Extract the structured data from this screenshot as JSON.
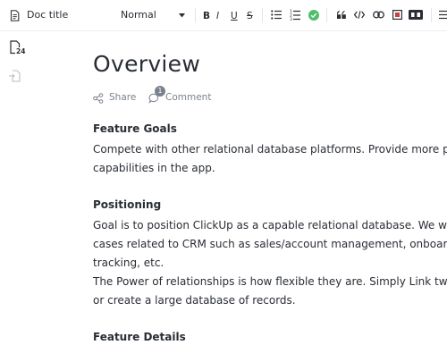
{
  "toolbar": {
    "doc_title": "Doc title",
    "text_style": "Normal",
    "format_letters": {
      "bold": "B",
      "italic": "I",
      "underline": "U",
      "strike": "S"
    },
    "icons": [
      "doc-icon",
      "chevron-down-icon",
      "bullet-list-icon",
      "numbered-list-icon",
      "checklist-icon",
      "quote-icon",
      "code-icon",
      "link-icon",
      "embed-icon",
      "banner-icon",
      "more-icon"
    ],
    "accent_color": "#4fbf6b"
  },
  "sidebar": {
    "page_count_badge": "24"
  },
  "document": {
    "heading": "Overview",
    "actions": {
      "share_label": "Share",
      "comment_label": "Comment",
      "comment_count": "1"
    },
    "sections": [
      {
        "title": "Feature Goals",
        "lines": [
          "Compete with other relational database platforms. Provide more p",
          "capabilities in the app."
        ]
      },
      {
        "title": "Positioning",
        "lines": [
          "Goal is to position ClickUp as a capable relational database. We w",
          "cases related to CRM such as sales/account management, onboar",
          "tracking, etc.",
          "The Power of relationships is how flexible they are. Simply Link tw",
          "or create a large database of records."
        ]
      },
      {
        "title": "Feature Details",
        "lines": []
      }
    ]
  }
}
